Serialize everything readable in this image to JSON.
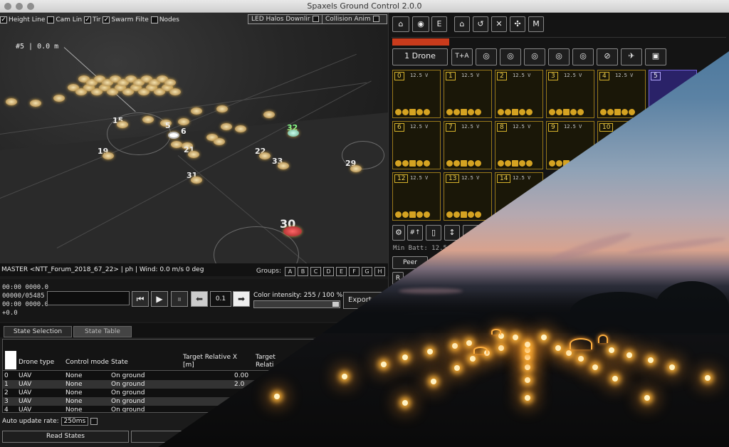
{
  "window": {
    "title": "Spaxels Ground Control 2.0.0"
  },
  "view": {
    "checkboxes": [
      {
        "label": "Height Line",
        "checked": true
      },
      {
        "label": "Cam Lin",
        "checked": false
      },
      {
        "label": "Tir",
        "checked": true
      },
      {
        "label": "Swarm Filte",
        "checked": true
      },
      {
        "label": "Nodes",
        "checked": false
      }
    ],
    "led_halos_label": "LED Halos Downlir",
    "collision_label": "Collision Anim",
    "distance_label": "#5 | 0.0 m",
    "drone_labels": [
      "15",
      "5",
      "6",
      "32",
      "19",
      "21",
      "22",
      "33",
      "29",
      "31",
      "30"
    ]
  },
  "status": {
    "master_text": "MASTER <NTT_Forum_2018_67_22> | ph | Wind: 0.0 m/s 0 deg",
    "groups_label": "Groups:",
    "groups": [
      "A",
      "B",
      "C",
      "D",
      "E",
      "F",
      "G",
      "H"
    ]
  },
  "timing": {
    "lines": [
      "00:00 0000.0",
      "00000/05485",
      "00:00 0000.0",
      "+0.0"
    ],
    "step_value": "0.1",
    "color_intensity": "Color intensity: 255 / 100 %",
    "export_label": "Export"
  },
  "tabs": {
    "state_selection": "State Selection",
    "state_table": "State Table"
  },
  "table": {
    "headers": [
      "Drone type",
      "Control mode",
      "State",
      "Target Relative X [m]",
      "Target Relati"
    ],
    "rows": [
      {
        "id": "0",
        "type": "UAV",
        "mode": "None",
        "state": "On ground",
        "x": "0.00"
      },
      {
        "id": "1",
        "type": "UAV",
        "mode": "None",
        "state": "On ground",
        "x": "2.0"
      },
      {
        "id": "2",
        "type": "UAV",
        "mode": "None",
        "state": "On ground",
        "x": ""
      },
      {
        "id": "3",
        "type": "UAV",
        "mode": "None",
        "state": "On ground",
        "x": ""
      },
      {
        "id": "4",
        "type": "UAV",
        "mode": "None",
        "state": "On ground",
        "x": ""
      }
    ]
  },
  "auto_update": {
    "label": "Auto update rate:",
    "value": "250ms"
  },
  "read_states": "Read States",
  "right": {
    "top_buttons": [
      "E",
      "M"
    ],
    "one_drone_label": "1 Drone",
    "ta_label": "T+A",
    "tiles": [
      {
        "num": "0",
        "volt": "12.5 V"
      },
      {
        "num": "1",
        "volt": "12.5 V"
      },
      {
        "num": "2",
        "volt": "12.5 V"
      },
      {
        "num": "3",
        "volt": "12.5 V"
      },
      {
        "num": "4",
        "volt": "12.5 V"
      },
      {
        "num": "5",
        "volt": ""
      },
      {
        "num": "6",
        "volt": "12.5 V"
      },
      {
        "num": "7",
        "volt": "12.5 V"
      },
      {
        "num": "8",
        "volt": "12.5 V"
      },
      {
        "num": "9",
        "volt": "12.5 V"
      },
      {
        "num": "10",
        "volt": ""
      },
      {
        "num": "12",
        "volt": "12.5 V"
      },
      {
        "num": "13",
        "volt": "12.5 V"
      },
      {
        "num": "14",
        "volt": "12.5 V"
      }
    ],
    "min_batt": "Min Batt: 12.5 V",
    "peer_label": "Peer",
    "r_label": "R"
  },
  "colors": {
    "tile_border": "#9a7a1a",
    "tile_accent": "#d5a322",
    "selected_tile": "#2a2268"
  }
}
